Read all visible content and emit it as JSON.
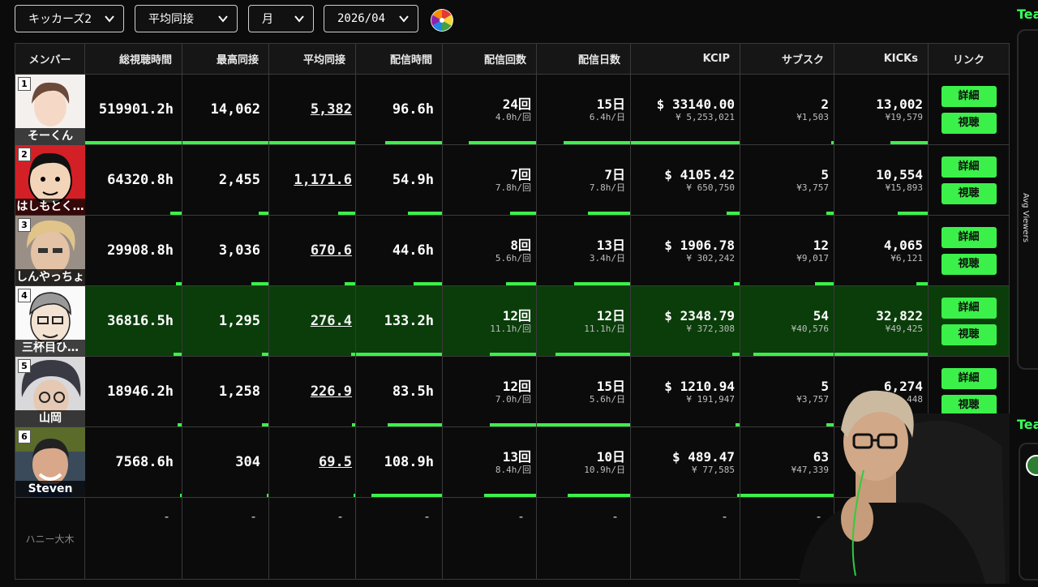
{
  "filters": {
    "team": "キッカーズ2",
    "metric": "平均同接",
    "period": "月",
    "month": "2026/04"
  },
  "right": {
    "title_top": "Tea",
    "title_bottom": "Tea",
    "avg_viewers_label": "Avg Viewers"
  },
  "columns": [
    "メンバー",
    "総視聴時間",
    "最高同接",
    "平均同接",
    "配信時間",
    "配信回数",
    "配信日数",
    "KCIP",
    "サブスク",
    "KICKs",
    "リンク"
  ],
  "buttons": {
    "detail": "詳細",
    "watch": "視聴"
  },
  "rows": [
    {
      "rank": "1",
      "name": "そーくん",
      "total_watch": "519901.2h",
      "peak": "14,062",
      "avg": "5,382",
      "stream_time": "96.6h",
      "count": "24回",
      "count_sub": "4.0h/回",
      "days": "15日",
      "days_sub": "6.4h/日",
      "kcip": "$ 33140.00",
      "kcip_sub": "¥ 5,253,021",
      "subs": "2",
      "subs_sub": "¥1,503",
      "kicks": "13,002",
      "kicks_sub": "¥19,579",
      "photo": "face-light",
      "hl": false
    },
    {
      "rank": "2",
      "name": "はしもとく…",
      "total_watch": "64320.8h",
      "peak": "2,455",
      "avg": "1,171.6",
      "stream_time": "54.9h",
      "count": "7回",
      "count_sub": "7.8h/回",
      "days": "7日",
      "days_sub": "7.8h/日",
      "kcip": "$ 4105.42",
      "kcip_sub": "¥ 650,750",
      "subs": "5",
      "subs_sub": "¥3,757",
      "kicks": "10,554",
      "kicks_sub": "¥15,893",
      "photo": "face-cartoon-red",
      "hl": false
    },
    {
      "rank": "3",
      "name": "しんやっちょ",
      "total_watch": "29908.8h",
      "peak": "3,036",
      "avg": "670.6",
      "stream_time": "44.6h",
      "count": "8回",
      "count_sub": "5.6h/回",
      "days": "13日",
      "days_sub": "3.4h/日",
      "kcip": "$ 1906.78",
      "kcip_sub": "¥ 302,242",
      "subs": "12",
      "subs_sub": "¥9,017",
      "kicks": "4,065",
      "kicks_sub": "¥6,121",
      "photo": "face-blond",
      "hl": false
    },
    {
      "rank": "4",
      "name": "三杯目ひ…",
      "total_watch": "36816.5h",
      "peak": "1,295",
      "avg": "276.4",
      "stream_time": "133.2h",
      "count": "12回",
      "count_sub": "11.1h/回",
      "days": "12日",
      "days_sub": "11.1h/日",
      "kcip": "$ 2348.79",
      "kcip_sub": "¥ 372,308",
      "subs": "54",
      "subs_sub": "¥40,576",
      "kicks": "32,822",
      "kicks_sub": "¥49,425",
      "photo": "face-sketch",
      "hl": true
    },
    {
      "rank": "5",
      "name": "山岡",
      "total_watch": "18946.2h",
      "peak": "1,258",
      "avg": "226.9",
      "stream_time": "83.5h",
      "count": "12回",
      "count_sub": "7.0h/回",
      "days": "15日",
      "days_sub": "5.6h/日",
      "kcip": "$ 1210.94",
      "kcip_sub": "¥ 191,947",
      "subs": "5",
      "subs_sub": "¥3,757",
      "kicks": "6,274",
      "kicks_sub": "448",
      "photo": "face-dark",
      "hl": false
    },
    {
      "rank": "6",
      "name": "Steven",
      "total_watch": "7568.6h",
      "peak": "304",
      "avg": "69.5",
      "stream_time": "108.9h",
      "count": "13回",
      "count_sub": "8.4h/回",
      "days": "10日",
      "days_sub": "10.9h/日",
      "kcip": "$ 489.47",
      "kcip_sub": "¥ 77,585",
      "subs": "63",
      "subs_sub": "¥47,339",
      "kicks": "",
      "kicks_sub": "",
      "photo": "face-smile",
      "hl": false
    }
  ],
  "empty_row": {
    "name": "ハニー大木",
    "dash": "-"
  },
  "bars": [
    [
      1.0,
      1.0,
      1.0,
      0.66,
      0.72,
      0.71,
      1.0,
      0.03,
      0.4
    ],
    [
      0.12,
      0.11,
      0.2,
      0.4,
      0.28,
      0.45,
      0.12,
      0.08,
      0.32
    ],
    [
      0.06,
      0.2,
      0.12,
      0.33,
      0.32,
      0.6,
      0.05,
      0.2,
      0.12
    ],
    [
      0.08,
      0.08,
      0.05,
      1.0,
      0.5,
      0.8,
      0.07,
      0.86,
      1.0
    ],
    [
      0.04,
      0.08,
      0.04,
      0.63,
      0.5,
      1.0,
      0.04,
      0.08,
      0.2
    ],
    [
      0.02,
      0.02,
      0.02,
      0.82,
      0.56,
      0.67,
      0.02,
      1.0,
      0.0
    ]
  ],
  "colors": {
    "accent": "#3cf04a",
    "highlight_row": "#0a3d0a",
    "avg_col": "#2a2a2a"
  }
}
